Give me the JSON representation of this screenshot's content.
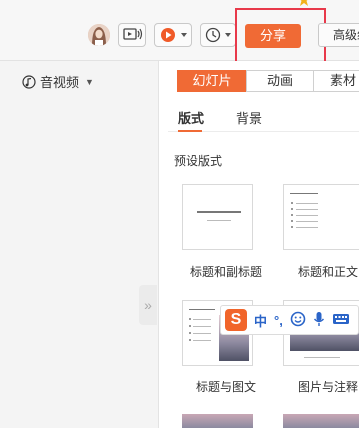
{
  "toolbar": {
    "share_label": "分享",
    "advanced_label": "高级组"
  },
  "left_panel": {
    "media_label": "音视频",
    "expand_handle": "»"
  },
  "right_panel": {
    "tabs": [
      "幻灯片",
      "动画",
      "素材"
    ],
    "subtabs": [
      "版式",
      "背景"
    ],
    "section_title": "预设版式",
    "layouts": [
      {
        "label": "标题和副标题"
      },
      {
        "label": "标题和正文"
      },
      {
        "label": "标题与图文"
      },
      {
        "label": "图片与注释"
      }
    ]
  },
  "ime": {
    "logo": "S",
    "lang": "中",
    "punct": "°,",
    "emoji": "☺",
    "voice": "mic",
    "keyboard": "kbd"
  },
  "colors": {
    "accent": "#f06a35",
    "highlight_box": "#e8394a"
  }
}
